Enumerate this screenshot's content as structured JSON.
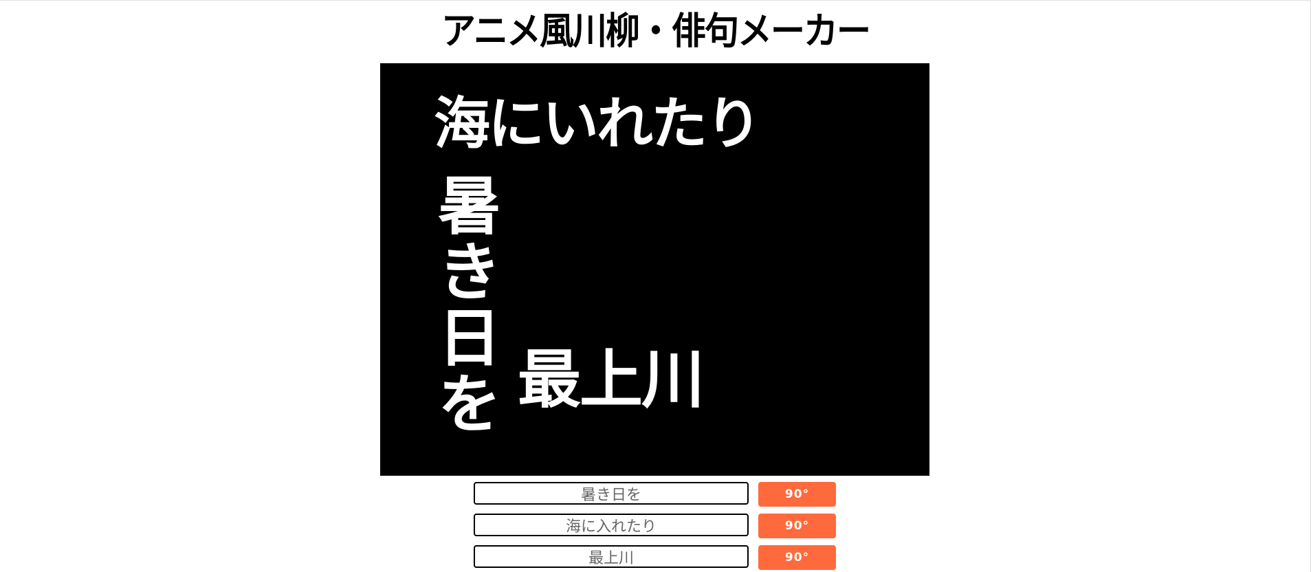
{
  "app": {
    "title": "アニメ風川柳・俳句メーカー"
  },
  "canvas": {
    "background": "#000000",
    "text_color": "#ffffff",
    "line1_horizontal": "海にいれたり",
    "line2_vertical": [
      "暑",
      "き",
      "日",
      "を"
    ],
    "line3_horizontal": "最上川"
  },
  "controls": {
    "rows": [
      {
        "value": "暑き日を",
        "rotate_label": "90°"
      },
      {
        "value": "海に入れたり",
        "rotate_label": "90°"
      },
      {
        "value": "最上川",
        "rotate_label": "90°"
      }
    ],
    "accent_color": "#ff6a3d"
  }
}
